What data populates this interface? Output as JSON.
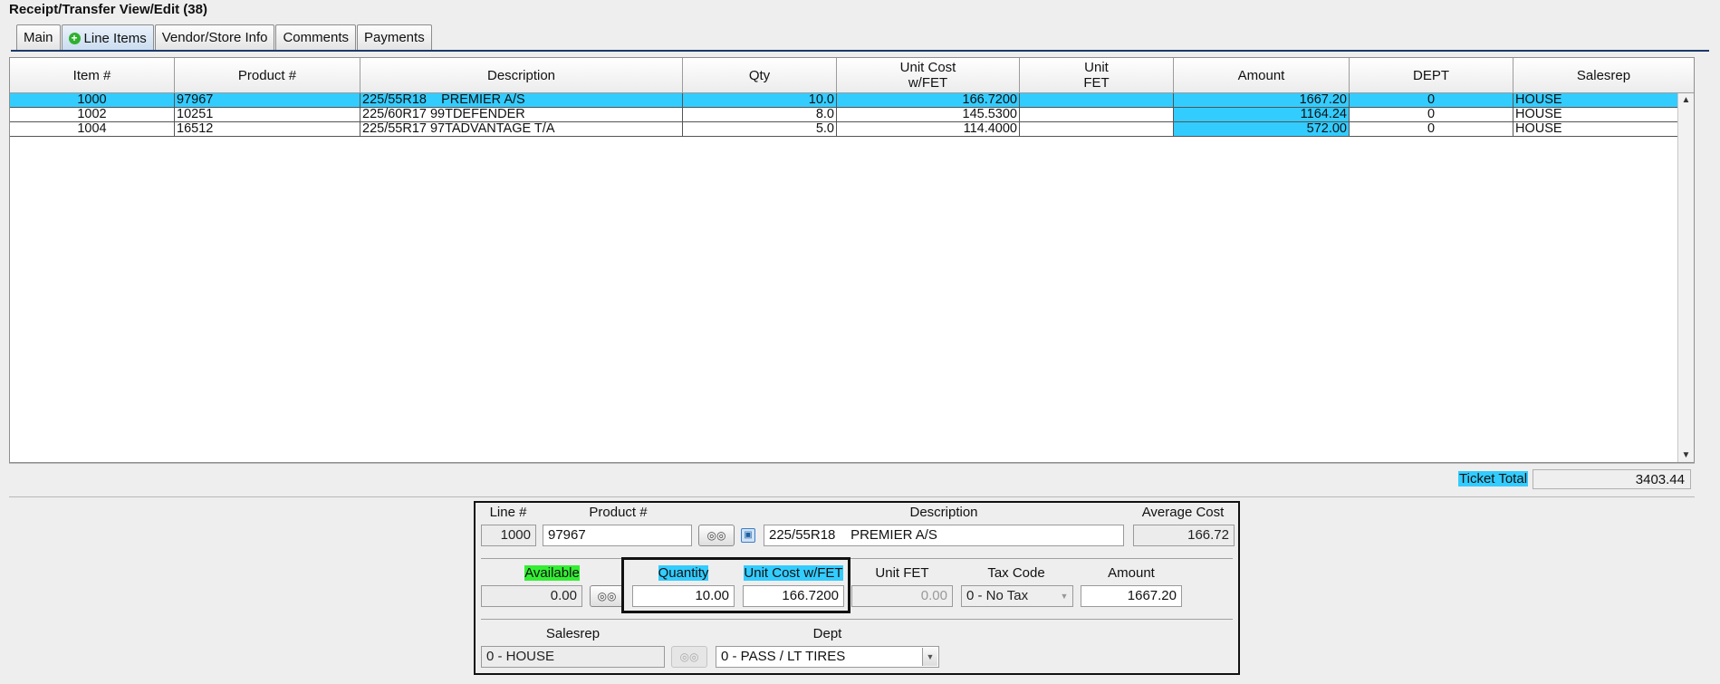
{
  "window": {
    "title": "Receipt/Transfer View/Edit  (38)"
  },
  "tabs": [
    {
      "label": "Main"
    },
    {
      "label": "Line Items",
      "active": true,
      "icon": "plus-circle-icon"
    },
    {
      "label": "Vendor/Store Info"
    },
    {
      "label": "Comments"
    },
    {
      "label": "Payments"
    }
  ],
  "grid": {
    "columns": [
      "Item #",
      "Product #",
      "Description",
      "Qty",
      "Unit Cost\nw/FET",
      "Unit\nFET",
      "Amount",
      "DEPT",
      "Salesrep"
    ],
    "rows": [
      {
        "item": "1000",
        "product": "97967",
        "description": "225/55R18    PREMIER A/S",
        "qty": "10.0",
        "unit_cost": "166.7200",
        "unit_fet": "",
        "amount": "1667.20",
        "dept": "0",
        "salesrep": "HOUSE",
        "selected": true
      },
      {
        "item": "1002",
        "product": "10251",
        "description": "225/60R17 99TDEFENDER",
        "qty": "8.0",
        "unit_cost": "145.5300",
        "unit_fet": "",
        "amount": "1164.24",
        "dept": "0",
        "salesrep": "HOUSE"
      },
      {
        "item": "1004",
        "product": "16512",
        "description": "225/55R17 97TADVANTAGE T/A",
        "qty": "5.0",
        "unit_cost": "114.4000",
        "unit_fet": "",
        "amount": "572.00",
        "dept": "0",
        "salesrep": "HOUSE"
      }
    ]
  },
  "totals": {
    "label": "Ticket Total",
    "value": "3403.44"
  },
  "detail": {
    "line_label": "Line #",
    "line_value": "1000",
    "product_label": "Product #",
    "product_value": "97967",
    "description_label": "Description",
    "description_value": "225/55R18    PREMIER A/S",
    "avg_cost_label": "Average Cost",
    "avg_cost_value": "166.72",
    "available_label": "Available",
    "available_value": "0.00",
    "quantity_label": "Quantity",
    "quantity_value": "10.00",
    "unit_cost_label": "Unit Cost w/FET",
    "unit_cost_value": "166.7200",
    "unit_fet_label": "Unit FET",
    "unit_fet_value": "0.00",
    "tax_code_label": "Tax Code",
    "tax_code_value": "0 - No Tax",
    "amount_label": "Amount",
    "amount_value": "1667.20",
    "salesrep_label": "Salesrep",
    "salesrep_value": "0 - HOUSE",
    "dept_label": "Dept",
    "dept_value": "0 - PASS / LT TIRES"
  },
  "colors": {
    "selection": "#33ccff",
    "available_highlight": "#33ee33"
  }
}
